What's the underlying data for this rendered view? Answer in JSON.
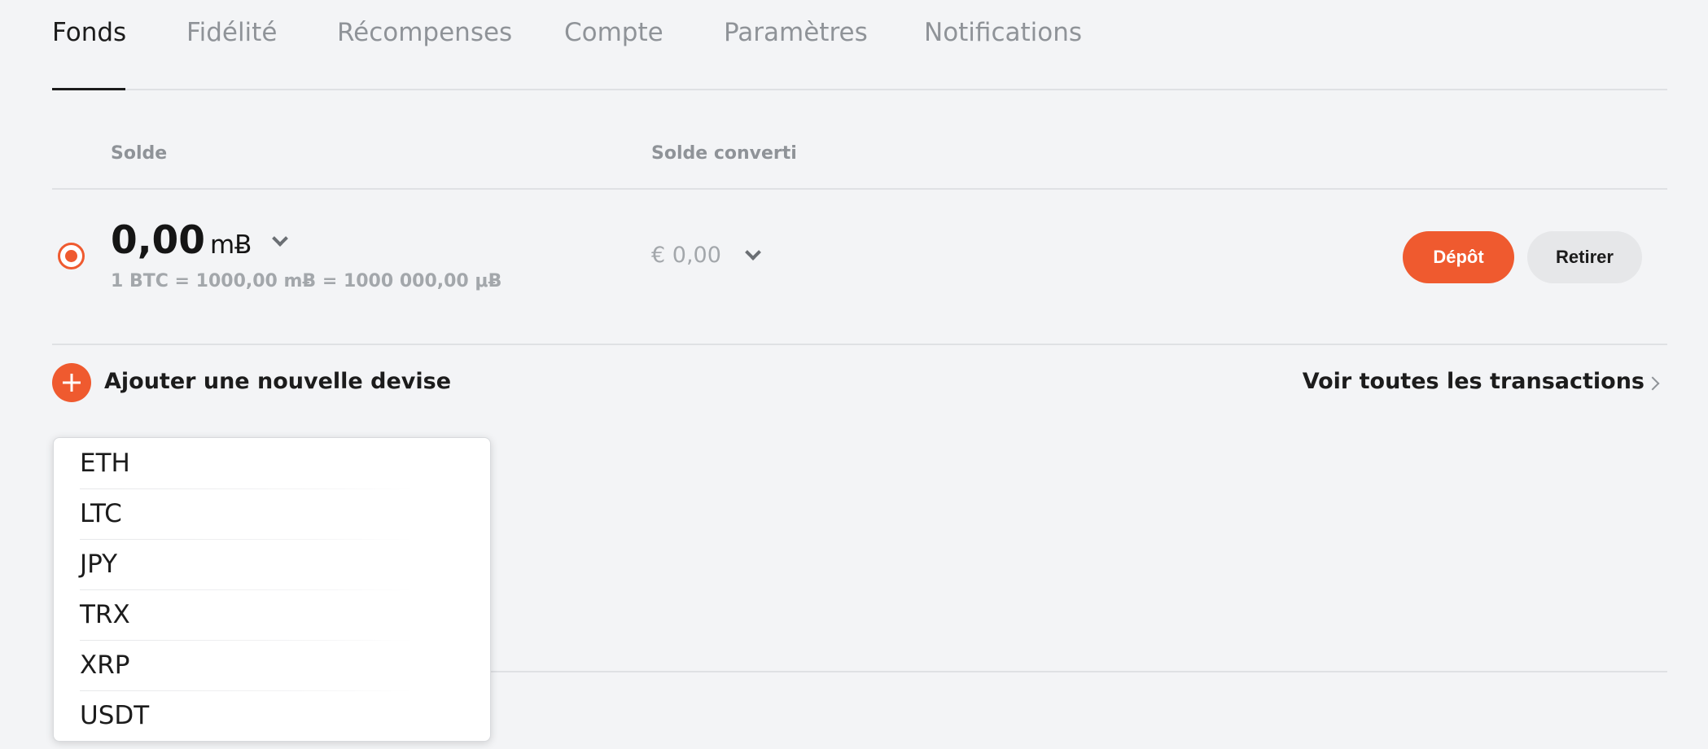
{
  "tabs": [
    {
      "label": "Fonds",
      "active": true
    },
    {
      "label": "Fidélité",
      "active": false
    },
    {
      "label": "Récompenses",
      "active": false
    },
    {
      "label": "Compte",
      "active": false
    },
    {
      "label": "Paramètres",
      "active": false
    },
    {
      "label": "Notifications",
      "active": false
    }
  ],
  "table": {
    "header_balance": "Solde",
    "header_converted": "Solde converti"
  },
  "balance_row": {
    "selected": true,
    "amount": "0,00",
    "unit": "mɃ",
    "rate": "1 BTC = 1000,00 mɃ = 1000 000,00 μɃ",
    "converted": "€ 0,00",
    "deposit_label": "Dépôt",
    "withdraw_label": "Retirer"
  },
  "actions": {
    "add_currency_label": "Ajouter une nouvelle devise",
    "view_all_transactions_label": "Voir toutes les transactions"
  },
  "currency_dropdown": {
    "options": [
      "ETH",
      "LTC",
      "JPY",
      "TRX",
      "XRP",
      "USDT"
    ]
  },
  "colors": {
    "accent": "#ef5a2f",
    "background": "#f3f4f6",
    "muted_text": "#8f9398"
  }
}
